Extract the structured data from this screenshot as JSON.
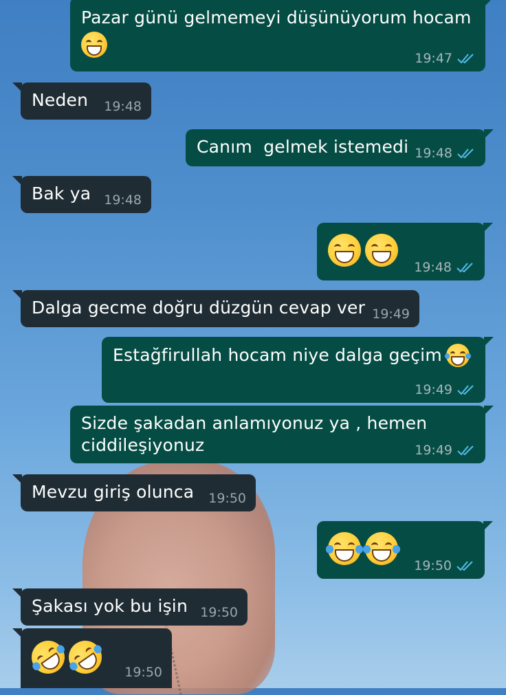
{
  "messages": [
    {
      "dir": "out",
      "text": "Pazar günü gelmemeyi düşünüyorum hocam",
      "emoji": "grin-icon",
      "time": "19:47",
      "ticks": "double-check-blue"
    },
    {
      "dir": "in",
      "text": "Neden",
      "time": "19:48"
    },
    {
      "dir": "out",
      "text": "Canım  gelmek istemedi",
      "time": "19:48",
      "ticks": "double-check-blue"
    },
    {
      "dir": "in",
      "text": "Bak ya",
      "time": "19:48"
    },
    {
      "dir": "out",
      "text": "",
      "emoji": [
        "grin-icon",
        "grin-icon"
      ],
      "time": "19:48",
      "ticks": "double-check-blue"
    },
    {
      "dir": "in",
      "text": "Dalga gecme doğru düzgün cevap ver",
      "time": "19:49"
    },
    {
      "dir": "out",
      "text": "Estağfirullah hocam niye dalga geçim",
      "emoji": "tears-of-joy-icon",
      "time": "19:49",
      "ticks": "double-check-blue"
    },
    {
      "dir": "out",
      "text": "Sizde şakadan anlamıyonuz ya , hemen ciddileşiyonuz",
      "time": "19:49",
      "ticks": "double-check-blue"
    },
    {
      "dir": "in",
      "text": "Mevzu giriş olunca",
      "time": "19:50"
    },
    {
      "dir": "out",
      "text": "",
      "emoji": [
        "tears-of-joy-icon",
        "tears-of-joy-icon"
      ],
      "time": "19:50",
      "ticks": "double-check-blue"
    },
    {
      "dir": "in",
      "text": "Şakası yok bu işin",
      "time": "19:50"
    },
    {
      "dir": "in",
      "text": "",
      "emoji": [
        "rofl-icon",
        "rofl-icon"
      ],
      "time": "19:50"
    }
  ],
  "colors": {
    "outgoing_bubble": "#054d44",
    "incoming_bubble": "#1f2c34",
    "read_ticks": "#53bdeb",
    "timestamp": "#a7b6bc"
  }
}
